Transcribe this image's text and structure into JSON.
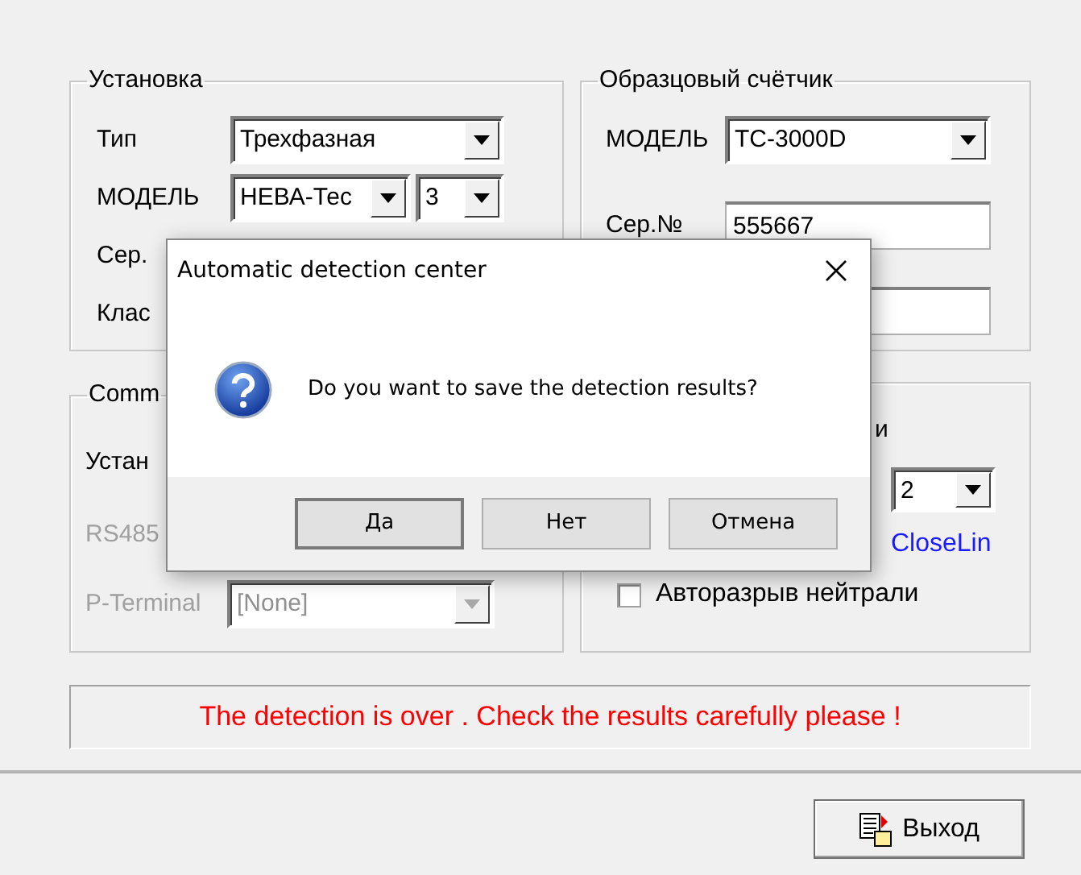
{
  "groups": [
    {
      "title": "Установка",
      "rows": [
        {
          "kind": "combo",
          "label": "Тип",
          "value": "Трехфазная"
        },
        {
          "kind": "combo-pair",
          "label": "МОДЕЛЬ",
          "value": "НЕВА-Тес",
          "value_2": "3"
        },
        {
          "kind": "label",
          "label": "Сер."
        },
        {
          "kind": "label",
          "label": "Клас"
        }
      ]
    },
    {
      "title": "Образцовый счётчик",
      "rows": [
        {
          "kind": "combo",
          "label": "МОДЕЛЬ",
          "value": "ТС-3000D"
        },
        {
          "kind": "text",
          "label": "Сер.№",
          "value": "555667"
        },
        {
          "kind": "text"
        }
      ]
    },
    {
      "title": "Comm",
      "rows": [
        {
          "kind": "label",
          "label": "Устан",
          "disabled": false
        },
        {
          "kind": "label",
          "label": "RS485",
          "disabled": true
        },
        {
          "kind": "combo",
          "label": "P-Terminal",
          "value": "[None]",
          "disabled": true
        }
      ]
    },
    {
      "rows": [
        {
          "kind": "label",
          "label": "и"
        },
        {
          "kind": "combo",
          "value": "2"
        },
        {
          "kind": "link",
          "label": "CloseLin"
        },
        {
          "kind": "checkbox",
          "label": "Авторазрыв нейтрали",
          "checked": false
        }
      ]
    }
  ],
  "status": "The detection is over . Check the results carefully please !",
  "exit_button": "Выход",
  "dialog": {
    "title": "Automatic detection center",
    "message": "Do you want to save the detection results?",
    "buttons": [
      {
        "label": "Да",
        "default": true
      },
      {
        "label": "Нет",
        "default": false
      },
      {
        "label": "Отмена",
        "default": false
      }
    ]
  }
}
